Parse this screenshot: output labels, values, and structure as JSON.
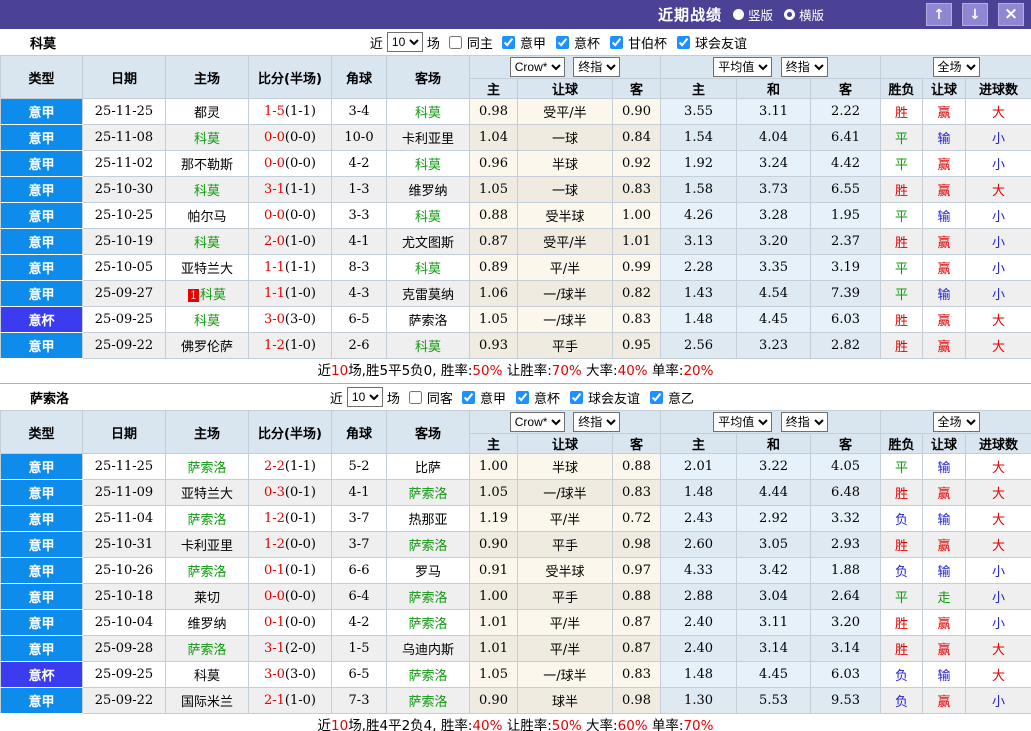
{
  "titlebar": {
    "title": "近期战绩",
    "radios": [
      {
        "label": "竖版",
        "selected": true
      },
      {
        "label": "横版",
        "selected": false
      }
    ],
    "buttons": {
      "up": "↑",
      "down": "↓",
      "close": "×"
    }
  },
  "filter_labels": {
    "near": "近",
    "count": "10",
    "matches": "场"
  },
  "columns": {
    "type": "类型",
    "date": "日期",
    "home": "主场",
    "score": "比分(半场)",
    "corner": "角球",
    "away": "客场",
    "odds_group": [
      "主",
      "让球",
      "客"
    ],
    "avg_group": [
      "主",
      "和",
      "客"
    ],
    "result_group": [
      "胜负",
      "让球",
      "进球数"
    ],
    "selects": {
      "odds_source": "Crow*",
      "odds_index": "终指",
      "avg_source": "平均值",
      "avg_index": "终指",
      "scope": "全场"
    }
  },
  "colors": {
    "league": "#0d8ceb",
    "cup": "#3b3bef",
    "self_team": "#0f9a0f",
    "score_red": "#e60000",
    "result_map": {
      "胜": "#e60000",
      "平": "#0a9a0a",
      "负": "#2323d6",
      "赢": "#e60000",
      "输": "#2323d6",
      "走": "#0a9a0a",
      "大": "#e60000",
      "小": "#2323d6"
    }
  },
  "sections": [
    {
      "team": "科莫",
      "same_label": "同主",
      "same_checked": false,
      "leagues": [
        "意甲",
        "意杯",
        "甘伯杯",
        "球会友谊"
      ],
      "rows": [
        {
          "t": "意甲",
          "cup": false,
          "d": "25-11-25",
          "h": "都灵",
          "hg": false,
          "bdg": "",
          "s": "1-5",
          "hf": "(1-1)",
          "c": "3-4",
          "a": "科莫",
          "ag": true,
          "o": [
            "0.98",
            "受平/半",
            "0.90"
          ],
          "v": [
            "3.55",
            "3.11",
            "2.22"
          ],
          "r": [
            "胜",
            "赢",
            "大"
          ]
        },
        {
          "t": "意甲",
          "cup": false,
          "d": "25-11-08",
          "h": "科莫",
          "hg": true,
          "bdg": "",
          "s": "0-0",
          "hf": "(0-0)",
          "c": "10-0",
          "a": "卡利亚里",
          "ag": false,
          "o": [
            "1.04",
            "一球",
            "0.84"
          ],
          "v": [
            "1.54",
            "4.04",
            "6.41"
          ],
          "r": [
            "平",
            "输",
            "小"
          ]
        },
        {
          "t": "意甲",
          "cup": false,
          "d": "25-11-02",
          "h": "那不勒斯",
          "hg": false,
          "bdg": "",
          "s": "0-0",
          "hf": "(0-0)",
          "c": "4-2",
          "a": "科莫",
          "ag": true,
          "o": [
            "0.96",
            "半球",
            "0.92"
          ],
          "v": [
            "1.92",
            "3.24",
            "4.42"
          ],
          "r": [
            "平",
            "赢",
            "小"
          ]
        },
        {
          "t": "意甲",
          "cup": false,
          "d": "25-10-30",
          "h": "科莫",
          "hg": true,
          "bdg": "",
          "s": "3-1",
          "hf": "(1-1)",
          "c": "1-3",
          "a": "维罗纳",
          "ag": false,
          "o": [
            "1.05",
            "一球",
            "0.83"
          ],
          "v": [
            "1.58",
            "3.73",
            "6.55"
          ],
          "r": [
            "胜",
            "赢",
            "大"
          ]
        },
        {
          "t": "意甲",
          "cup": false,
          "d": "25-10-25",
          "h": "帕尔马",
          "hg": false,
          "bdg": "",
          "s": "0-0",
          "hf": "(0-0)",
          "c": "3-3",
          "a": "科莫",
          "ag": true,
          "o": [
            "0.88",
            "受半球",
            "1.00"
          ],
          "v": [
            "4.26",
            "3.28",
            "1.95"
          ],
          "r": [
            "平",
            "输",
            "小"
          ]
        },
        {
          "t": "意甲",
          "cup": false,
          "d": "25-10-19",
          "h": "科莫",
          "hg": true,
          "bdg": "",
          "s": "2-0",
          "hf": "(1-0)",
          "c": "4-1",
          "a": "尤文图斯",
          "ag": false,
          "o": [
            "0.87",
            "受平/半",
            "1.01"
          ],
          "v": [
            "3.13",
            "3.20",
            "2.37"
          ],
          "r": [
            "胜",
            "赢",
            "小"
          ]
        },
        {
          "t": "意甲",
          "cup": false,
          "d": "25-10-05",
          "h": "亚特兰大",
          "hg": false,
          "bdg": "",
          "s": "1-1",
          "hf": "(1-1)",
          "c": "8-3",
          "a": "科莫",
          "ag": true,
          "o": [
            "0.89",
            "平/半",
            "0.99"
          ],
          "v": [
            "2.28",
            "3.35",
            "3.19"
          ],
          "r": [
            "平",
            "赢",
            "小"
          ]
        },
        {
          "t": "意甲",
          "cup": false,
          "d": "25-09-27",
          "h": "科莫",
          "hg": true,
          "bdg": "1",
          "s": "1-1",
          "hf": "(1-0)",
          "c": "4-3",
          "a": "克雷莫纳",
          "ag": false,
          "o": [
            "1.06",
            "一/球半",
            "0.82"
          ],
          "v": [
            "1.43",
            "4.54",
            "7.39"
          ],
          "r": [
            "平",
            "输",
            "小"
          ]
        },
        {
          "t": "意杯",
          "cup": true,
          "d": "25-09-25",
          "h": "科莫",
          "hg": true,
          "bdg": "",
          "s": "3-0",
          "hf": "(3-0)",
          "c": "6-5",
          "a": "萨索洛",
          "ag": false,
          "o": [
            "1.05",
            "一/球半",
            "0.83"
          ],
          "v": [
            "1.48",
            "4.45",
            "6.03"
          ],
          "r": [
            "胜",
            "赢",
            "大"
          ]
        },
        {
          "t": "意甲",
          "cup": false,
          "d": "25-09-22",
          "h": "佛罗伦萨",
          "hg": false,
          "bdg": "",
          "s": "1-2",
          "hf": "(1-0)",
          "c": "2-6",
          "a": "科莫",
          "ag": true,
          "o": [
            "0.93",
            "平手",
            "0.95"
          ],
          "v": [
            "2.56",
            "3.23",
            "2.82"
          ],
          "r": [
            "胜",
            "赢",
            "大"
          ]
        }
      ],
      "summary": [
        {
          "t": "近",
          "c": "k"
        },
        {
          "t": "10",
          "c": "r"
        },
        {
          "t": "场,胜5平5负0, 胜率:",
          "c": "k"
        },
        {
          "t": "50%",
          "c": "r"
        },
        {
          "t": " 让胜率:",
          "c": "k"
        },
        {
          "t": "70%",
          "c": "r"
        },
        {
          "t": " 大率:",
          "c": "k"
        },
        {
          "t": "40%",
          "c": "r"
        },
        {
          "t": " 单率:",
          "c": "k"
        },
        {
          "t": "20%",
          "c": "r"
        }
      ]
    },
    {
      "team": "萨索洛",
      "same_label": "同客",
      "same_checked": false,
      "leagues": [
        "意甲",
        "意杯",
        "球会友谊",
        "意乙"
      ],
      "rows": [
        {
          "t": "意甲",
          "cup": false,
          "d": "25-11-25",
          "h": "萨索洛",
          "hg": true,
          "bdg": "",
          "s": "2-2",
          "hf": "(1-1)",
          "c": "5-2",
          "a": "比萨",
          "ag": false,
          "o": [
            "1.00",
            "半球",
            "0.88"
          ],
          "v": [
            "2.01",
            "3.22",
            "4.05"
          ],
          "r": [
            "平",
            "输",
            "大"
          ]
        },
        {
          "t": "意甲",
          "cup": false,
          "d": "25-11-09",
          "h": "亚特兰大",
          "hg": false,
          "bdg": "",
          "s": "0-3",
          "hf": "(0-1)",
          "c": "4-1",
          "a": "萨索洛",
          "ag": true,
          "o": [
            "1.05",
            "一/球半",
            "0.83"
          ],
          "v": [
            "1.48",
            "4.44",
            "6.48"
          ],
          "r": [
            "胜",
            "赢",
            "大"
          ]
        },
        {
          "t": "意甲",
          "cup": false,
          "d": "25-11-04",
          "h": "萨索洛",
          "hg": true,
          "bdg": "",
          "s": "1-2",
          "hf": "(0-1)",
          "c": "3-7",
          "a": "热那亚",
          "ag": false,
          "o": [
            "1.19",
            "平/半",
            "0.72"
          ],
          "v": [
            "2.43",
            "2.92",
            "3.32"
          ],
          "r": [
            "负",
            "输",
            "大"
          ]
        },
        {
          "t": "意甲",
          "cup": false,
          "d": "25-10-31",
          "h": "卡利亚里",
          "hg": false,
          "bdg": "",
          "s": "1-2",
          "hf": "(0-0)",
          "c": "3-7",
          "a": "萨索洛",
          "ag": true,
          "o": [
            "0.90",
            "平手",
            "0.98"
          ],
          "v": [
            "2.60",
            "3.05",
            "2.93"
          ],
          "r": [
            "胜",
            "赢",
            "大"
          ]
        },
        {
          "t": "意甲",
          "cup": false,
          "d": "25-10-26",
          "h": "萨索洛",
          "hg": true,
          "bdg": "",
          "s": "0-1",
          "hf": "(0-1)",
          "c": "6-6",
          "a": "罗马",
          "ag": false,
          "o": [
            "0.91",
            "受半球",
            "0.97"
          ],
          "v": [
            "4.33",
            "3.42",
            "1.88"
          ],
          "r": [
            "负",
            "输",
            "小"
          ]
        },
        {
          "t": "意甲",
          "cup": false,
          "d": "25-10-18",
          "h": "莱切",
          "hg": false,
          "bdg": "",
          "s": "0-0",
          "hf": "(0-0)",
          "c": "6-4",
          "a": "萨索洛",
          "ag": true,
          "o": [
            "1.00",
            "平手",
            "0.88"
          ],
          "v": [
            "2.88",
            "3.04",
            "2.64"
          ],
          "r": [
            "平",
            "走",
            "小"
          ]
        },
        {
          "t": "意甲",
          "cup": false,
          "d": "25-10-04",
          "h": "维罗纳",
          "hg": false,
          "bdg": "",
          "s": "0-1",
          "hf": "(0-0)",
          "c": "4-2",
          "a": "萨索洛",
          "ag": true,
          "o": [
            "1.01",
            "平/半",
            "0.87"
          ],
          "v": [
            "2.40",
            "3.11",
            "3.20"
          ],
          "r": [
            "胜",
            "赢",
            "小"
          ]
        },
        {
          "t": "意甲",
          "cup": false,
          "d": "25-09-28",
          "h": "萨索洛",
          "hg": true,
          "bdg": "",
          "s": "3-1",
          "hf": "(2-0)",
          "c": "1-5",
          "a": "乌迪内斯",
          "ag": false,
          "o": [
            "1.01",
            "平/半",
            "0.87"
          ],
          "v": [
            "2.40",
            "3.14",
            "3.14"
          ],
          "r": [
            "胜",
            "赢",
            "大"
          ]
        },
        {
          "t": "意杯",
          "cup": true,
          "d": "25-09-25",
          "h": "科莫",
          "hg": false,
          "bdg": "",
          "s": "3-0",
          "hf": "(3-0)",
          "c": "6-5",
          "a": "萨索洛",
          "ag": true,
          "o": [
            "1.05",
            "一/球半",
            "0.83"
          ],
          "v": [
            "1.48",
            "4.45",
            "6.03"
          ],
          "r": [
            "负",
            "输",
            "大"
          ]
        },
        {
          "t": "意甲",
          "cup": false,
          "d": "25-09-22",
          "h": "国际米兰",
          "hg": false,
          "bdg": "",
          "s": "2-1",
          "hf": "(1-0)",
          "c": "7-3",
          "a": "萨索洛",
          "ag": true,
          "o": [
            "0.90",
            "球半",
            "0.98"
          ],
          "v": [
            "1.30",
            "5.53",
            "9.53"
          ],
          "r": [
            "负",
            "赢",
            "小"
          ]
        }
      ],
      "summary": [
        {
          "t": "近",
          "c": "k"
        },
        {
          "t": "10",
          "c": "r"
        },
        {
          "t": "场,胜4平2负4, 胜率:",
          "c": "k"
        },
        {
          "t": "40%",
          "c": "r"
        },
        {
          "t": " 让胜率:",
          "c": "k"
        },
        {
          "t": "50%",
          "c": "r"
        },
        {
          "t": " 大率:",
          "c": "k"
        },
        {
          "t": "60%",
          "c": "r"
        },
        {
          "t": " 单率:",
          "c": "k"
        },
        {
          "t": "70%",
          "c": "r"
        }
      ]
    }
  ]
}
